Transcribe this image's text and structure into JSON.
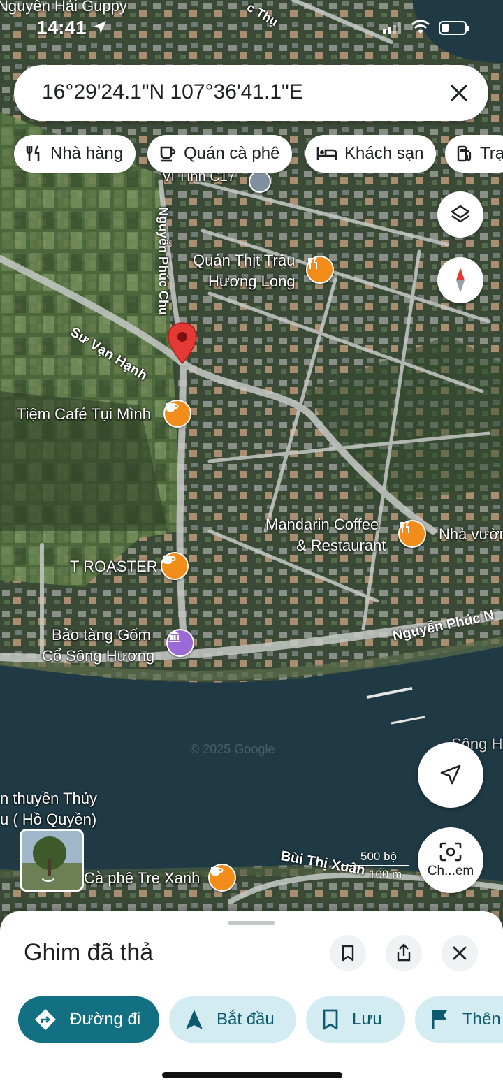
{
  "status": {
    "time": "14:41",
    "top_label": "Nguyễn Hải Guppy"
  },
  "search": {
    "query": "16°29'24.1\"N 107°36'41.1\"E"
  },
  "chips": [
    {
      "label": "Nhà hàng",
      "icon": "restaurant-icon"
    },
    {
      "label": "Quán cà phê",
      "icon": "coffee-icon"
    },
    {
      "label": "Khách sạn",
      "icon": "hotel-icon"
    },
    {
      "label": "Trạ",
      "icon": "gas-station-icon"
    }
  ],
  "map": {
    "places": {
      "vi_tinh": "Vi Tính C17",
      "thit_trau_1": "Quán Thịt Trâu",
      "thit_trau_2": "Hương Long",
      "tiem_cafe": "Tiệm Café Tụi Mình",
      "mandarin_1": "Mandarin Coffee",
      "mandarin_2": "& Restaurant",
      "nha_vuon": "Nhà vườn",
      "t_roaster": "T ROASTER",
      "bao_tang_1": "Bảo tàng Gốm",
      "bao_tang_2": "Cổ Sông Hương",
      "thuyen_1": "n thuyền Thủy",
      "thuyen_2": "u ( Hồ Quyền)",
      "tre_xanh": "Cà phê Tre Xanh",
      "song": "Sông H"
    },
    "roads": {
      "su_van_hanh": "Sư Vạn Hạnh",
      "nguyen_phuc_chu": "Nguyễn Phúc Chu",
      "nguyen_phuc_n": "Nguyễn Phúc N",
      "bui_thi_xuan": "Bùi Thị Xuân",
      "van_thu": "c Thụ"
    },
    "watermark": "© 2025 Google",
    "scale": {
      "feet": "500 bộ",
      "meters": "100 m"
    },
    "lens_label": "Ch...em"
  },
  "sheet": {
    "title": "Ghim đã thả",
    "actions": [
      {
        "label": "Đường đi",
        "icon": "directions-icon"
      },
      {
        "label": "Bắt đầu",
        "icon": "navigation-arrow-icon"
      },
      {
        "label": "Lưu",
        "icon": "bookmark-icon"
      },
      {
        "label": "Thên",
        "icon": "flag-icon"
      }
    ]
  },
  "colors": {
    "accent": "#137082",
    "action_bg": "#d3ecf2",
    "poi_orange": "#f28c1b",
    "poi_purple": "#9c6ad6",
    "pin_red": "#e53935"
  }
}
